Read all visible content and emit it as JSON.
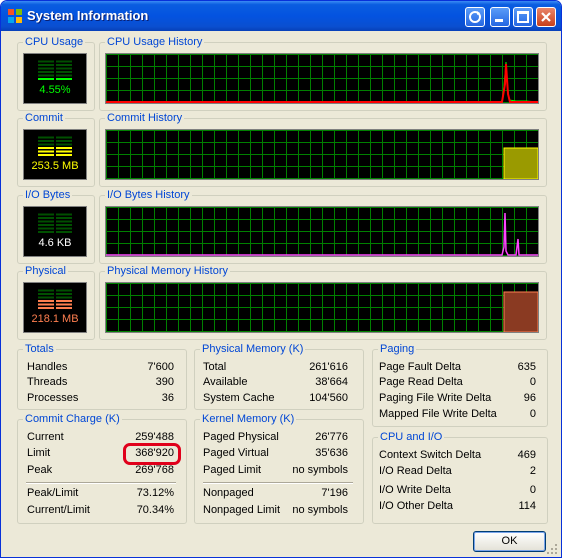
{
  "window": {
    "title": "System Information"
  },
  "colors": {
    "cpu": "#00ff00",
    "commit": "#ffff00",
    "io": "#ff44ff",
    "physical": "#ff7f50",
    "grid": "#008000"
  },
  "cpu": {
    "group_label": "CPU Usage",
    "value": "4.55%",
    "history_label": "CPU Usage History"
  },
  "commit_meter": {
    "group_label": "Commit",
    "value": "253.5 MB",
    "history_label": "Commit History"
  },
  "io": {
    "group_label": "I/O Bytes",
    "value": "4.6  KB",
    "history_label": "I/O Bytes History"
  },
  "physical_meter": {
    "group_label": "Physical",
    "value": "218.1 MB",
    "history_label": "Physical Memory History"
  },
  "totals": {
    "label": "Totals",
    "rows": [
      {
        "name": "Handles",
        "value": "7'600"
      },
      {
        "name": "Threads",
        "value": "390"
      },
      {
        "name": "Processes",
        "value": "36"
      }
    ]
  },
  "commit_charge": {
    "label": "Commit Charge (K)",
    "rows": [
      {
        "name": "Current",
        "value": "259'488"
      },
      {
        "name": "Limit",
        "value": "368'920"
      },
      {
        "name": "Peak",
        "value": "269'768"
      }
    ],
    "ratios": [
      {
        "name": "Peak/Limit",
        "value": "73.12%"
      },
      {
        "name": "Current/Limit",
        "value": "70.34%"
      }
    ]
  },
  "physical_memory": {
    "label": "Physical Memory (K)",
    "rows": [
      {
        "name": "Total",
        "value": "261'616"
      },
      {
        "name": "Available",
        "value": "38'664"
      },
      {
        "name": "System Cache",
        "value": "104'560"
      }
    ]
  },
  "kernel_memory": {
    "label": "Kernel Memory (K)",
    "rows": [
      {
        "name": "Paged Physical",
        "value": "26'776"
      },
      {
        "name": "Paged Virtual",
        "value": "35'636"
      },
      {
        "name": "Paged Limit",
        "value": "no symbols"
      }
    ],
    "rows2": [
      {
        "name": "Nonpaged",
        "value": "7'196"
      },
      {
        "name": "Nonpaged Limit",
        "value": "no symbols"
      }
    ]
  },
  "paging": {
    "label": "Paging",
    "rows": [
      {
        "name": "Page Fault Delta",
        "value": "635"
      },
      {
        "name": "Page Read Delta",
        "value": "0"
      },
      {
        "name": "Paging File Write Delta",
        "value": "96"
      },
      {
        "name": "Mapped File Write Delta",
        "value": "0"
      }
    ]
  },
  "cpu_io": {
    "label": "CPU and I/O",
    "rows": [
      {
        "name": "Context Switch Delta",
        "value": "469"
      },
      {
        "name": "I/O Read Delta",
        "value": "2"
      },
      {
        "name": "I/O Write Delta",
        "value": "0"
      },
      {
        "name": "I/O Other Delta",
        "value": "114"
      }
    ]
  },
  "buttons": {
    "ok": "OK"
  }
}
